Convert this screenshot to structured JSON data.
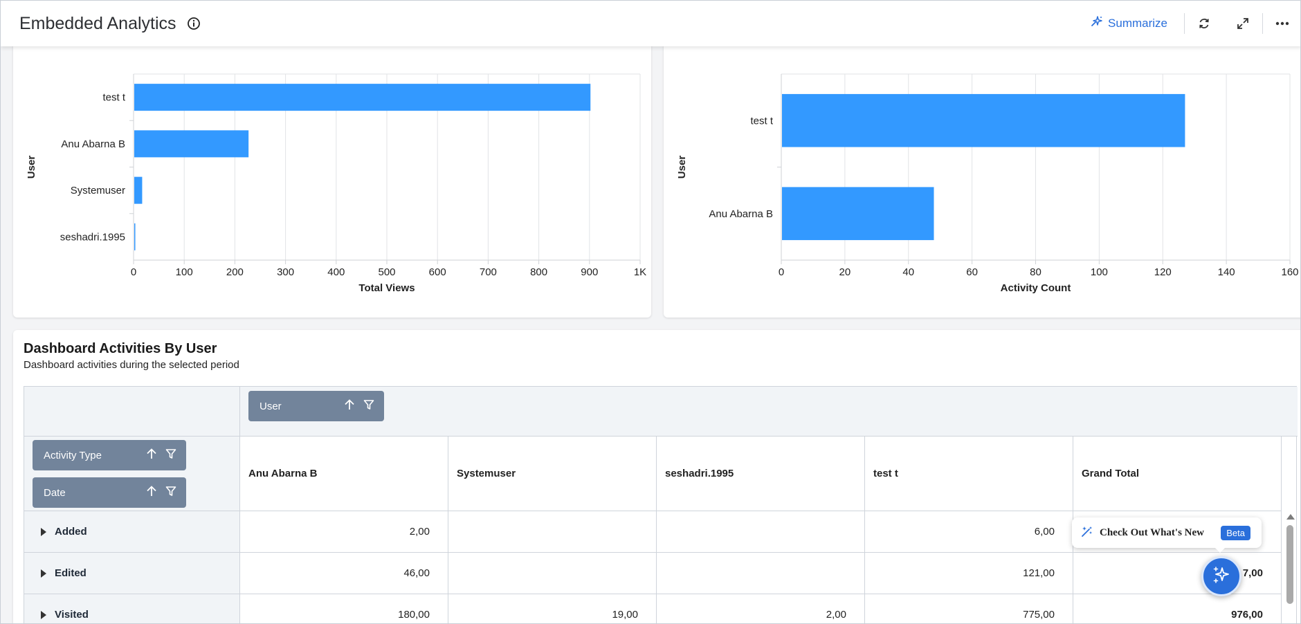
{
  "header": {
    "title": "Embedded Analytics",
    "summarize_label": "Summarize",
    "icons": [
      "info-icon",
      "sparkle-icon",
      "refresh-icon",
      "expand-icon",
      "more-icon"
    ]
  },
  "left_chart": {
    "xlabel": "Total Views",
    "ylabel": "User"
  },
  "right_chart": {
    "xlabel": "Activity Count",
    "ylabel": "User"
  },
  "chart_data": [
    {
      "type": "bar",
      "orientation": "horizontal",
      "categories": [
        "test t",
        "Anu Abarna B",
        "Systemuser",
        "seshadri.1995"
      ],
      "values": [
        902,
        227,
        17,
        2
      ],
      "xlabel": "Total Views",
      "ylabel": "User",
      "xlim": [
        0,
        1000
      ],
      "xticks": [
        "0",
        "100",
        "200",
        "300",
        "400",
        "500",
        "600",
        "700",
        "800",
        "900",
        "1K"
      ],
      "grid": true,
      "color": "#3399ff"
    },
    {
      "type": "bar",
      "orientation": "horizontal",
      "categories": [
        "test t",
        "Anu Abarna B"
      ],
      "values": [
        127,
        48
      ],
      "xlabel": "Activity Count",
      "ylabel": "User",
      "xlim": [
        0,
        160
      ],
      "xticks": [
        "0",
        "20",
        "40",
        "60",
        "80",
        "100",
        "120",
        "140",
        "160"
      ],
      "grid": true,
      "color": "#3399ff"
    }
  ],
  "table_section": {
    "title": "Dashboard Activities By User",
    "subtitle": "Dashboard activities during the selected period",
    "column_field": "User",
    "row_fields": [
      "Activity Type",
      "Date"
    ],
    "columns": [
      "Anu Abarna B",
      "Systemuser",
      "seshadri.1995",
      "test t",
      "Grand Total"
    ],
    "rows": [
      {
        "label": "Added",
        "cells": [
          "2,00",
          "",
          "",
          "6,00",
          ""
        ]
      },
      {
        "label": "Edited",
        "cells": [
          "46,00",
          "",
          "",
          "121,00",
          "7,00"
        ]
      },
      {
        "label": "Visited",
        "cells": [
          "180,00",
          "19,00",
          "2,00",
          "775,00",
          "976,00"
        ]
      }
    ]
  },
  "whats_new": {
    "label": "Check Out What's New",
    "badge": "Beta"
  },
  "colors": {
    "accent": "#2a6fdb",
    "bar": "#3399ff",
    "chip": "#72849b"
  }
}
